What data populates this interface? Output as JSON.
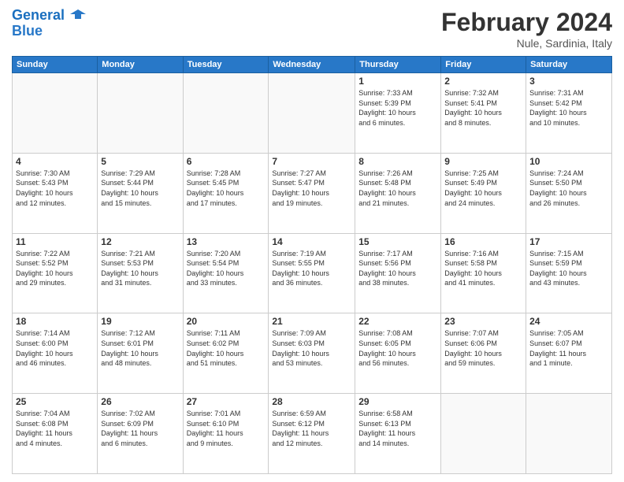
{
  "header": {
    "logo_line1": "General",
    "logo_line2": "Blue",
    "title": "February 2024",
    "subtitle": "Nule, Sardinia, Italy"
  },
  "calendar": {
    "days_of_week": [
      "Sunday",
      "Monday",
      "Tuesday",
      "Wednesday",
      "Thursday",
      "Friday",
      "Saturday"
    ],
    "weeks": [
      [
        {
          "day": "",
          "info": ""
        },
        {
          "day": "",
          "info": ""
        },
        {
          "day": "",
          "info": ""
        },
        {
          "day": "",
          "info": ""
        },
        {
          "day": "1",
          "info": "Sunrise: 7:33 AM\nSunset: 5:39 PM\nDaylight: 10 hours\nand 6 minutes."
        },
        {
          "day": "2",
          "info": "Sunrise: 7:32 AM\nSunset: 5:41 PM\nDaylight: 10 hours\nand 8 minutes."
        },
        {
          "day": "3",
          "info": "Sunrise: 7:31 AM\nSunset: 5:42 PM\nDaylight: 10 hours\nand 10 minutes."
        }
      ],
      [
        {
          "day": "4",
          "info": "Sunrise: 7:30 AM\nSunset: 5:43 PM\nDaylight: 10 hours\nand 12 minutes."
        },
        {
          "day": "5",
          "info": "Sunrise: 7:29 AM\nSunset: 5:44 PM\nDaylight: 10 hours\nand 15 minutes."
        },
        {
          "day": "6",
          "info": "Sunrise: 7:28 AM\nSunset: 5:45 PM\nDaylight: 10 hours\nand 17 minutes."
        },
        {
          "day": "7",
          "info": "Sunrise: 7:27 AM\nSunset: 5:47 PM\nDaylight: 10 hours\nand 19 minutes."
        },
        {
          "day": "8",
          "info": "Sunrise: 7:26 AM\nSunset: 5:48 PM\nDaylight: 10 hours\nand 21 minutes."
        },
        {
          "day": "9",
          "info": "Sunrise: 7:25 AM\nSunset: 5:49 PM\nDaylight: 10 hours\nand 24 minutes."
        },
        {
          "day": "10",
          "info": "Sunrise: 7:24 AM\nSunset: 5:50 PM\nDaylight: 10 hours\nand 26 minutes."
        }
      ],
      [
        {
          "day": "11",
          "info": "Sunrise: 7:22 AM\nSunset: 5:52 PM\nDaylight: 10 hours\nand 29 minutes."
        },
        {
          "day": "12",
          "info": "Sunrise: 7:21 AM\nSunset: 5:53 PM\nDaylight: 10 hours\nand 31 minutes."
        },
        {
          "day": "13",
          "info": "Sunrise: 7:20 AM\nSunset: 5:54 PM\nDaylight: 10 hours\nand 33 minutes."
        },
        {
          "day": "14",
          "info": "Sunrise: 7:19 AM\nSunset: 5:55 PM\nDaylight: 10 hours\nand 36 minutes."
        },
        {
          "day": "15",
          "info": "Sunrise: 7:17 AM\nSunset: 5:56 PM\nDaylight: 10 hours\nand 38 minutes."
        },
        {
          "day": "16",
          "info": "Sunrise: 7:16 AM\nSunset: 5:58 PM\nDaylight: 10 hours\nand 41 minutes."
        },
        {
          "day": "17",
          "info": "Sunrise: 7:15 AM\nSunset: 5:59 PM\nDaylight: 10 hours\nand 43 minutes."
        }
      ],
      [
        {
          "day": "18",
          "info": "Sunrise: 7:14 AM\nSunset: 6:00 PM\nDaylight: 10 hours\nand 46 minutes."
        },
        {
          "day": "19",
          "info": "Sunrise: 7:12 AM\nSunset: 6:01 PM\nDaylight: 10 hours\nand 48 minutes."
        },
        {
          "day": "20",
          "info": "Sunrise: 7:11 AM\nSunset: 6:02 PM\nDaylight: 10 hours\nand 51 minutes."
        },
        {
          "day": "21",
          "info": "Sunrise: 7:09 AM\nSunset: 6:03 PM\nDaylight: 10 hours\nand 53 minutes."
        },
        {
          "day": "22",
          "info": "Sunrise: 7:08 AM\nSunset: 6:05 PM\nDaylight: 10 hours\nand 56 minutes."
        },
        {
          "day": "23",
          "info": "Sunrise: 7:07 AM\nSunset: 6:06 PM\nDaylight: 10 hours\nand 59 minutes."
        },
        {
          "day": "24",
          "info": "Sunrise: 7:05 AM\nSunset: 6:07 PM\nDaylight: 11 hours\nand 1 minute."
        }
      ],
      [
        {
          "day": "25",
          "info": "Sunrise: 7:04 AM\nSunset: 6:08 PM\nDaylight: 11 hours\nand 4 minutes."
        },
        {
          "day": "26",
          "info": "Sunrise: 7:02 AM\nSunset: 6:09 PM\nDaylight: 11 hours\nand 6 minutes."
        },
        {
          "day": "27",
          "info": "Sunrise: 7:01 AM\nSunset: 6:10 PM\nDaylight: 11 hours\nand 9 minutes."
        },
        {
          "day": "28",
          "info": "Sunrise: 6:59 AM\nSunset: 6:12 PM\nDaylight: 11 hours\nand 12 minutes."
        },
        {
          "day": "29",
          "info": "Sunrise: 6:58 AM\nSunset: 6:13 PM\nDaylight: 11 hours\nand 14 minutes."
        },
        {
          "day": "",
          "info": ""
        },
        {
          "day": "",
          "info": ""
        }
      ]
    ]
  }
}
